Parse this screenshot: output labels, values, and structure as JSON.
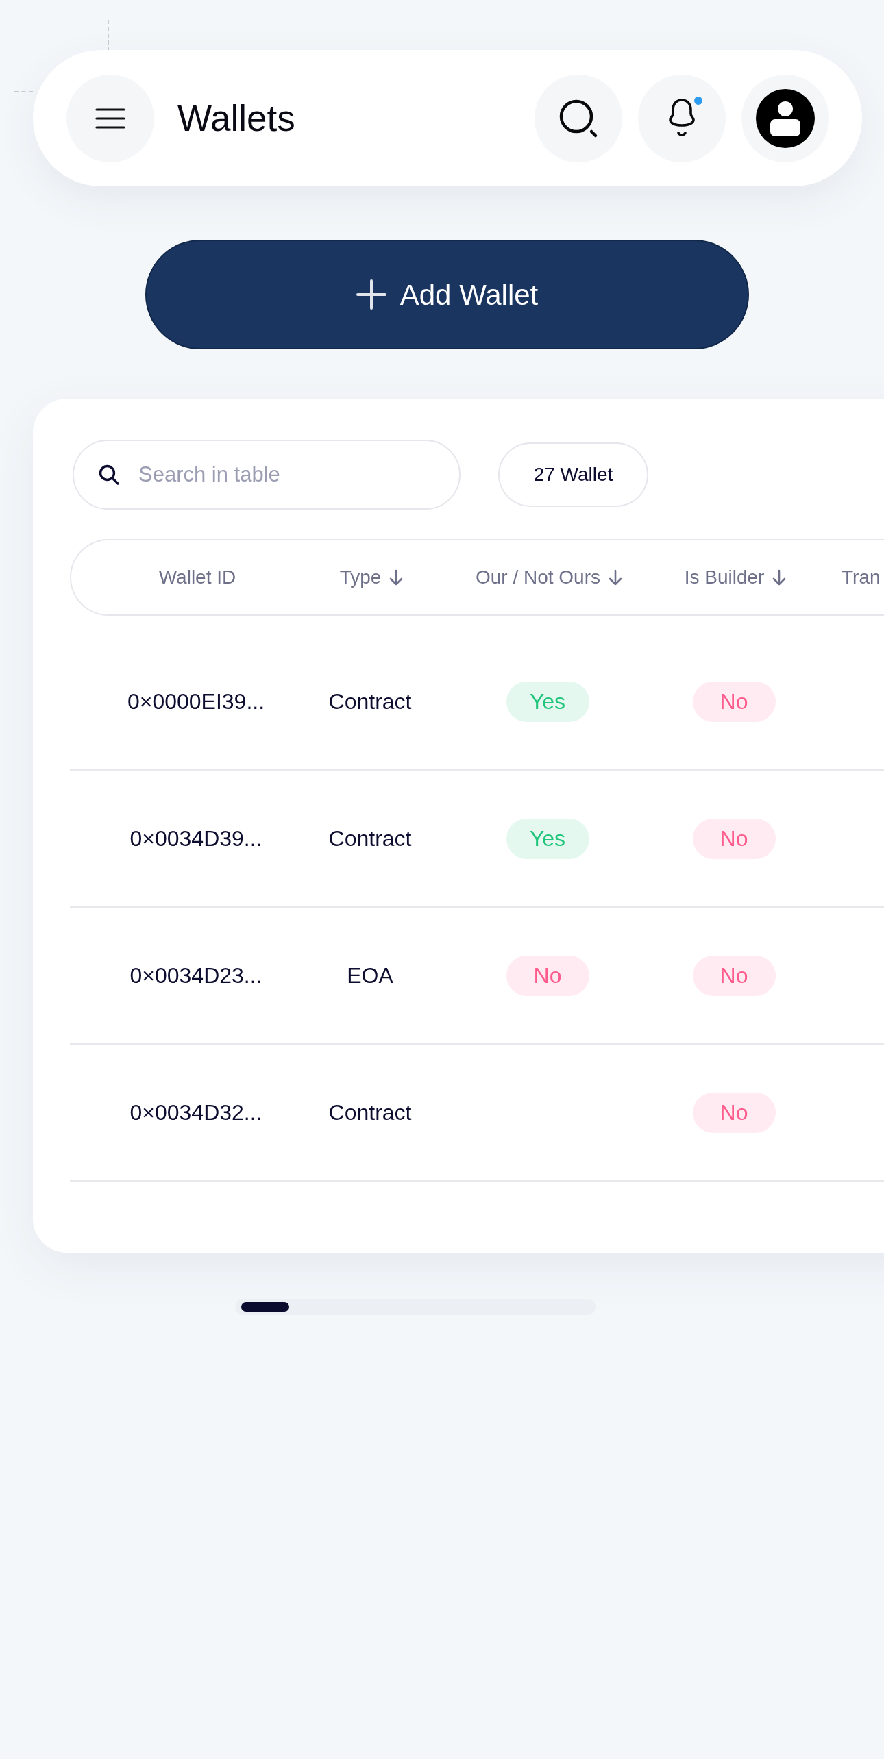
{
  "header": {
    "title": "Wallets",
    "unread_notifications": true
  },
  "add_button": {
    "label": "Add Wallet"
  },
  "table_card": {
    "search": {
      "placeholder": "Search in table"
    },
    "count": "27 Wallet",
    "columns": [
      {
        "label": "Wallet ID",
        "sort_arrow": false
      },
      {
        "label": "Type",
        "sort_arrow": true
      },
      {
        "label": "Our / Not Ours",
        "sort_arrow": true
      },
      {
        "label": "Is Builder",
        "sort_arrow": true
      },
      {
        "label": "Tran",
        "sort_arrow": false
      }
    ],
    "rows": [
      {
        "wallet_id": "0×0000EI39...",
        "type": "Contract",
        "ours": {
          "text": "Yes",
          "color": "#1ec57a"
        },
        "is_builder": {
          "text": "No",
          "color": "#ff5b8c"
        }
      },
      {
        "wallet_id": "0×0034D39...",
        "type": "Contract",
        "ours": {
          "text": "Yes",
          "color": "#1ec57a"
        },
        "is_builder": {
          "text": "No",
          "color": "#ff5b8c"
        }
      },
      {
        "wallet_id": "0×0034D23...",
        "type": "EOA",
        "ours": {
          "text": "No",
          "color": "#ff5b8c"
        },
        "is_builder": {
          "text": "No",
          "color": "#ff5b8c"
        }
      },
      {
        "wallet_id": "0×0034D32...",
        "type": "Contract",
        "is_builder": {
          "text": "No",
          "color": "#ff5b8c"
        }
      }
    ]
  }
}
